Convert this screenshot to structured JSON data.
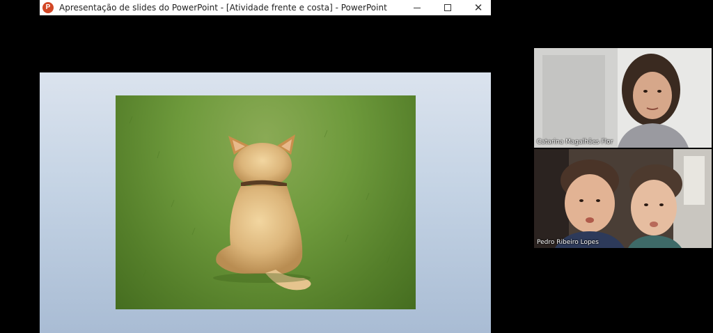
{
  "window": {
    "title": "Apresentação de slides do PowerPoint - [Atividade frente e costa] - PowerPoint",
    "app_icon_letter": "P",
    "close_glyph": "✕"
  },
  "slide": {
    "image_description_icon": "dog-photo-icon"
  },
  "participants": [
    {
      "name": "Catarina Magalhães Flor"
    },
    {
      "name": "Pedro Ribeiro Lopes"
    }
  ],
  "colors": {
    "app_icon": "#d24726",
    "background": "#000000"
  }
}
